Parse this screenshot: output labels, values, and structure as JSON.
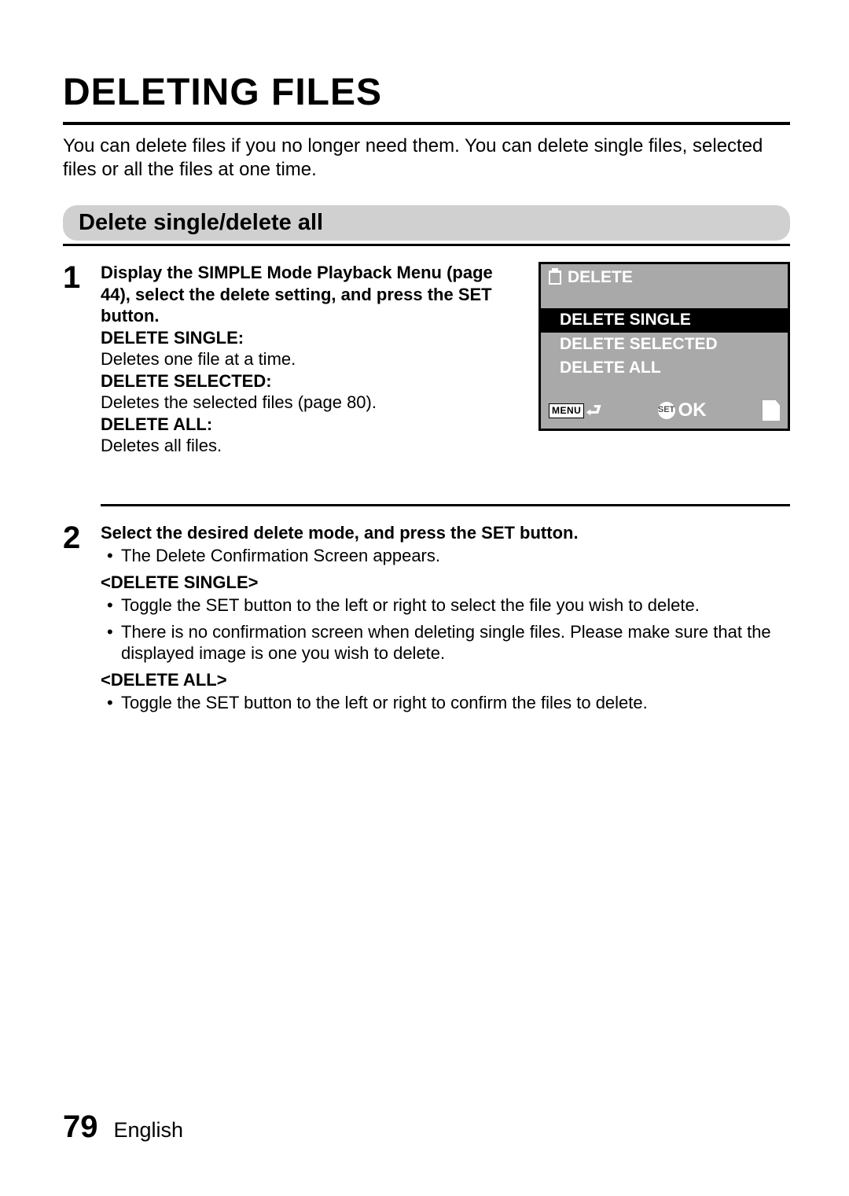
{
  "title": "DELETING FILES",
  "intro": "You can delete files if you no longer need them. You can delete single files, selected files or all the files at one time.",
  "section_heading": "Delete single/delete all",
  "step1": {
    "num": "1",
    "lead": "Display the SIMPLE Mode Playback Menu (page 44), select the delete setting, and press the SET button.",
    "opt1_label": "DELETE SINGLE:",
    "opt1_desc": "Deletes one file at a time.",
    "opt2_label": "DELETE SELECTED:",
    "opt2_desc": "Deletes the selected files (page 80).",
    "opt3_label": "DELETE ALL:",
    "opt3_desc": "Deletes all files."
  },
  "screen": {
    "header": "DELETE",
    "items": [
      "DELETE SINGLE",
      "DELETE SELECTED",
      "DELETE ALL"
    ],
    "menu_label": "MENU",
    "ok_label": "OK",
    "set_label": "SET"
  },
  "step2": {
    "num": "2",
    "lead": "Select the desired delete mode, and press the SET button.",
    "bullet0": "The Delete Confirmation Screen appears.",
    "sub1_label": "<DELETE SINGLE>",
    "sub1_b1": "Toggle the SET button to the left or right to select the file you wish to delete.",
    "sub1_b2": "There is no confirmation screen when deleting single files. Please make sure that the displayed image is one you wish to delete.",
    "sub2_label": "<DELETE ALL>",
    "sub2_b1": "Toggle the SET button to the left or right to confirm the files to delete."
  },
  "footer": {
    "page": "79",
    "lang": "English"
  }
}
